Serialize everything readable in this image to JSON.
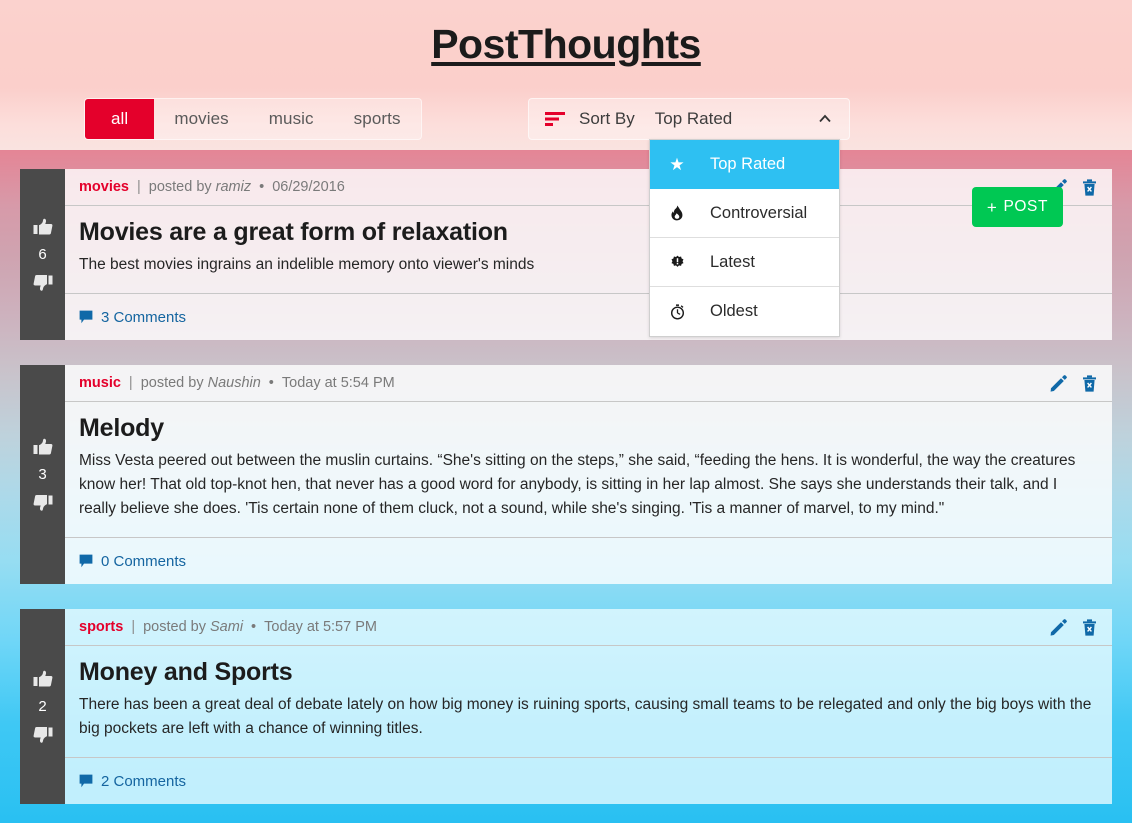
{
  "header": {
    "title": "PostThoughts"
  },
  "toolbar": {
    "categories": [
      {
        "label": "all",
        "active": true
      },
      {
        "label": "movies",
        "active": false
      },
      {
        "label": "music",
        "active": false
      },
      {
        "label": "sports",
        "active": false
      }
    ],
    "sort": {
      "icon": "sort-icon",
      "label": "Sort By",
      "value": "Top Rated",
      "chevron": "chevron-up-icon",
      "options": [
        {
          "label": "Top Rated",
          "icon": "star-icon",
          "selected": true
        },
        {
          "label": "Controversial",
          "icon": "fire-icon",
          "selected": false
        },
        {
          "label": "Latest",
          "icon": "new-badge-icon",
          "selected": false
        },
        {
          "label": "Oldest",
          "icon": "stopwatch-icon",
          "selected": false
        }
      ]
    },
    "post_button": {
      "plus": "+",
      "label": "POST"
    }
  },
  "colors": {
    "accent_red": "#e4002b",
    "post_green": "#00c853",
    "dropdown_highlight": "#2ec0f2",
    "link_blue": "#1565a0",
    "vote_bar": "#4a4a4a"
  },
  "posts": [
    {
      "category": "movies",
      "separator": "|",
      "posted_by": "posted by",
      "author": "ramiz",
      "dot": "•",
      "date": "06/29/2016",
      "title": "Movies are a great form of relaxation",
      "text": "The best movies ingrains an indelible memory onto viewer's minds",
      "votes": "6",
      "comments": "3 Comments",
      "tinted": false
    },
    {
      "category": "music",
      "separator": "|",
      "posted_by": "posted by",
      "author": "Naushin",
      "dot": "•",
      "date": "Today at 5:54 PM",
      "title": "Melody",
      "text": "Miss Vesta peered out between the muslin curtains. “She's sitting on the steps,” she said, “feeding the hens. It is wonderful, the way the creatures know her! That old top-knot hen, that never has a good word for anybody, is sitting in her lap almost. She says she understands their talk, and I really believe she does. 'Tis certain none of them cluck, not a sound, while she's singing. 'Tis a manner of marvel, to my mind.\"",
      "votes": "3",
      "comments": "0 Comments",
      "tinted": false
    },
    {
      "category": "sports",
      "separator": "|",
      "posted_by": "posted by",
      "author": "Sami",
      "dot": "•",
      "date": "Today at 5:57 PM",
      "title": "Money and Sports",
      "text": "There has been a great deal of debate lately on how big money is ruining sports, causing small teams to be relegated and only the big boys with the big pockets are left with a chance of winning titles.",
      "votes": "2",
      "comments": "2 Comments",
      "tinted": true
    }
  ],
  "icons": {
    "thumbs_up": "thumbs-up-icon",
    "thumbs_down": "thumbs-down-icon",
    "edit": "edit-pencil-icon",
    "delete": "delete-trash-icon",
    "comment": "comment-icon"
  }
}
